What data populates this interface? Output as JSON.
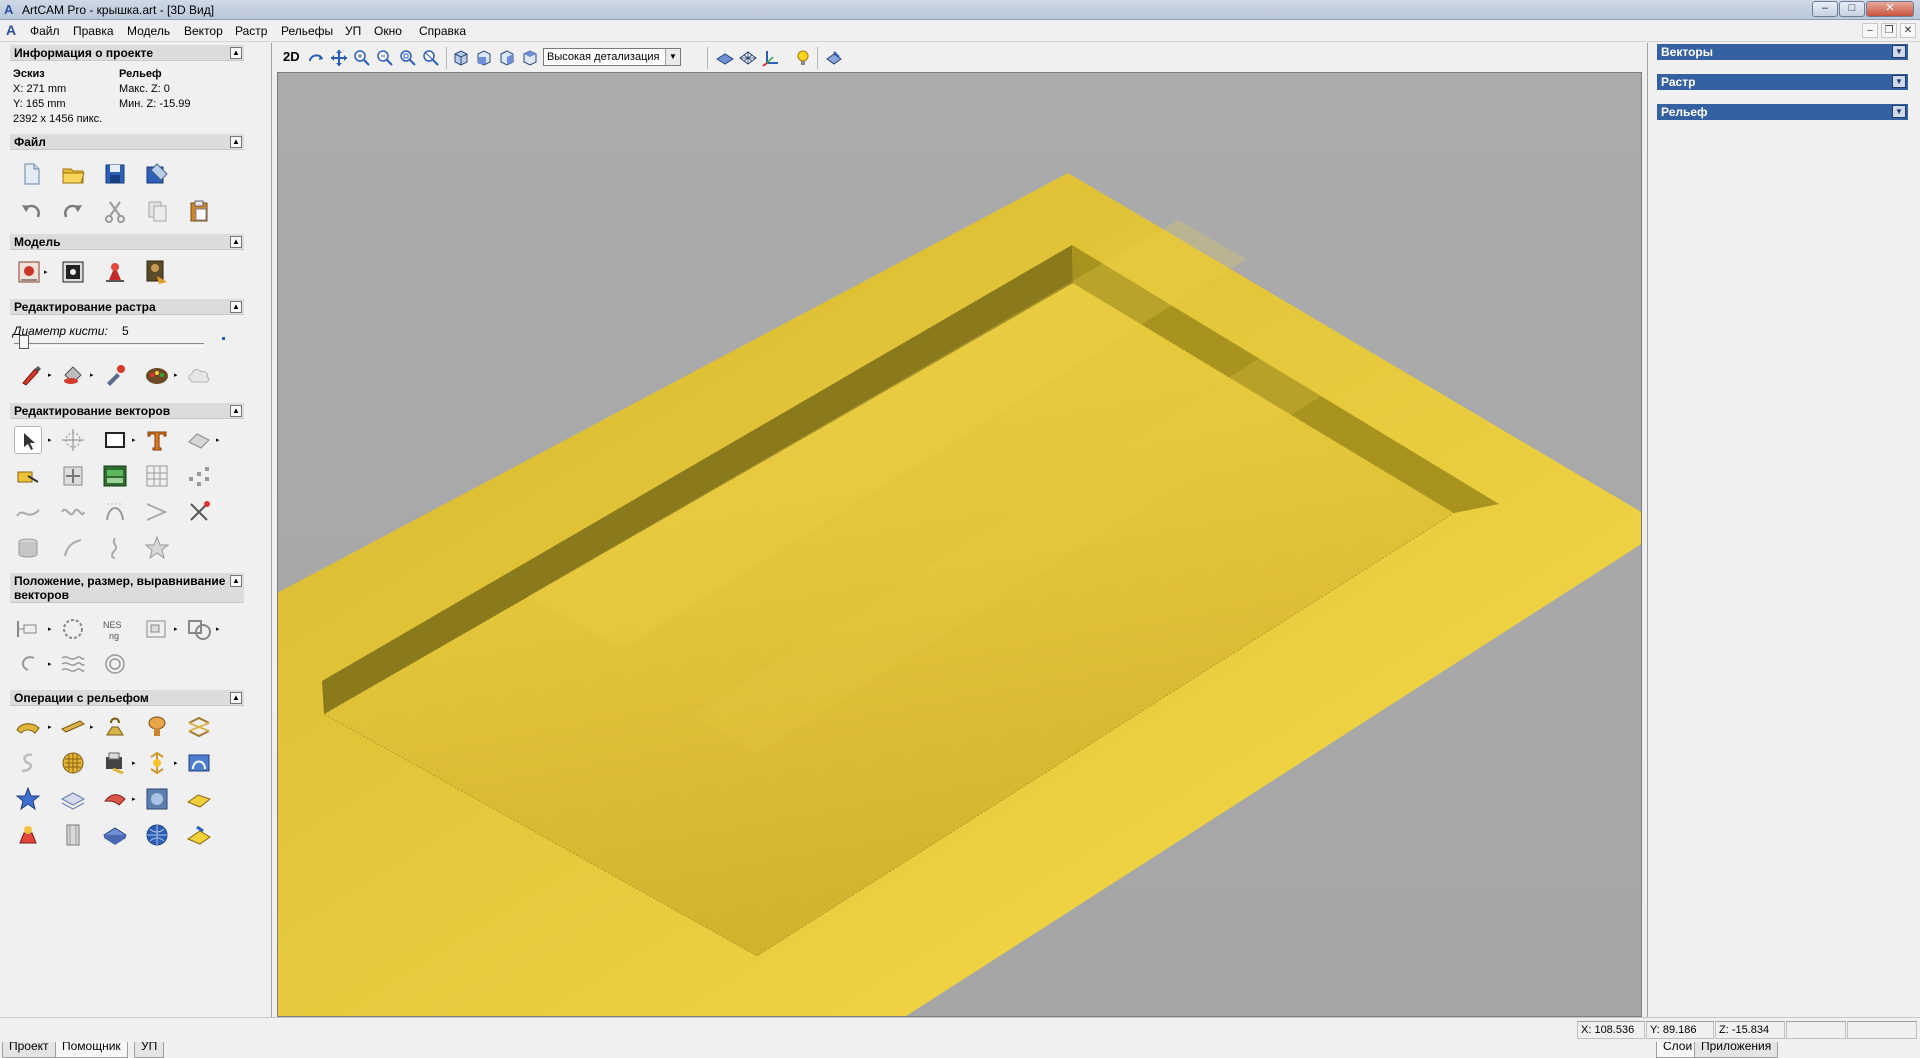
{
  "window": {
    "title": "ArtCAM Pro - крышка.art - [3D Вид]",
    "min_glyph": "–",
    "max_glyph": "□",
    "close_glyph": "✕"
  },
  "menu": {
    "items": [
      "Файл",
      "Правка",
      "Модель",
      "Вектор",
      "Растр",
      "Рельефы",
      "УП",
      "Окно",
      "Справка"
    ],
    "mdi_min": "–",
    "mdi_restore": "❐",
    "mdi_close": "✕"
  },
  "project_info": {
    "header": "Информация о проекте",
    "sketch_label": "Эскиз",
    "relief_label": "Рельеф",
    "x": "X: 271 mm",
    "y": "Y: 165 mm",
    "pixels": "2392 x 1456 пикс.",
    "max_z": "Макс. Z: 0",
    "min_z": "Мин. Z: -15.99"
  },
  "sections": {
    "file": "Файл",
    "model": "Модель",
    "raster_edit": "Редактирование растра",
    "vector_edit": "Редактирование векторов",
    "vector_position": "Положение, размер, выравнивание векторов",
    "relief_ops": "Операции с рельефом"
  },
  "brush": {
    "label": "Диаметр кисти:",
    "value": "5",
    "level": 0.03
  },
  "left_tabs": [
    "Проект",
    "Помощник",
    "УП"
  ],
  "toolbar": {
    "mode_label": "2D",
    "detail_value": "Высокая детализация"
  },
  "right_panel": {
    "layers": [
      "Векторы",
      "Растр",
      "Рельеф"
    ],
    "tabs": [
      "Слои",
      "Приложения"
    ]
  },
  "status": {
    "x": "X: 108.536",
    "y": "Y: 89.186",
    "z": "Z: -15.834"
  },
  "colors": {
    "relief_yellow": "#e0c43a",
    "viewport_bg": "#aaaaaa",
    "layer_header": "#3561a3"
  }
}
